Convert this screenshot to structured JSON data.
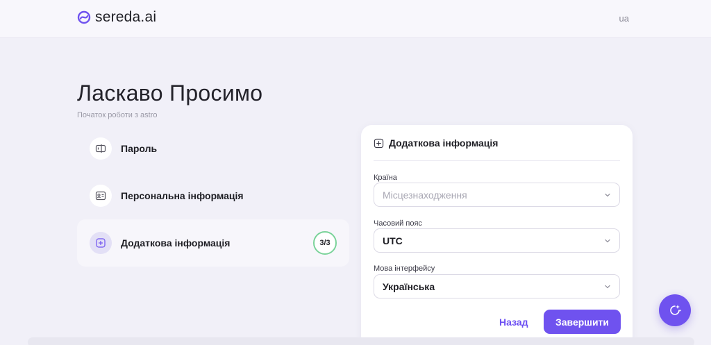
{
  "header": {
    "logo_text": "sereda.ai",
    "language": "ua"
  },
  "page": {
    "title": "Ласкаво Просимо",
    "subtitle": "Початок роботи з astro"
  },
  "steps": [
    {
      "label": "Пароль",
      "icon": "password-icon",
      "active": false
    },
    {
      "label": "Персональна інформація",
      "icon": "id-card-icon",
      "active": false
    },
    {
      "label": "Додаткова інформація",
      "icon": "plus-square-icon",
      "active": true,
      "badge": "3/3"
    }
  ],
  "form": {
    "heading": "Додаткова інформація",
    "fields": [
      {
        "label": "Країна",
        "value": "Місцезнаходження",
        "is_placeholder": true
      },
      {
        "label": "Часовий пояс",
        "value": "UTC",
        "is_placeholder": false
      },
      {
        "label": "Мова інтерфейсу",
        "value": "Українська",
        "is_placeholder": false
      }
    ],
    "back_label": "Назад",
    "finish_label": "Завершити"
  },
  "colors": {
    "accent": "#6f52ef",
    "badge_ring": "#7bd39a",
    "background": "#f1f0f8"
  },
  "fab_icon": "magic-wand-icon"
}
